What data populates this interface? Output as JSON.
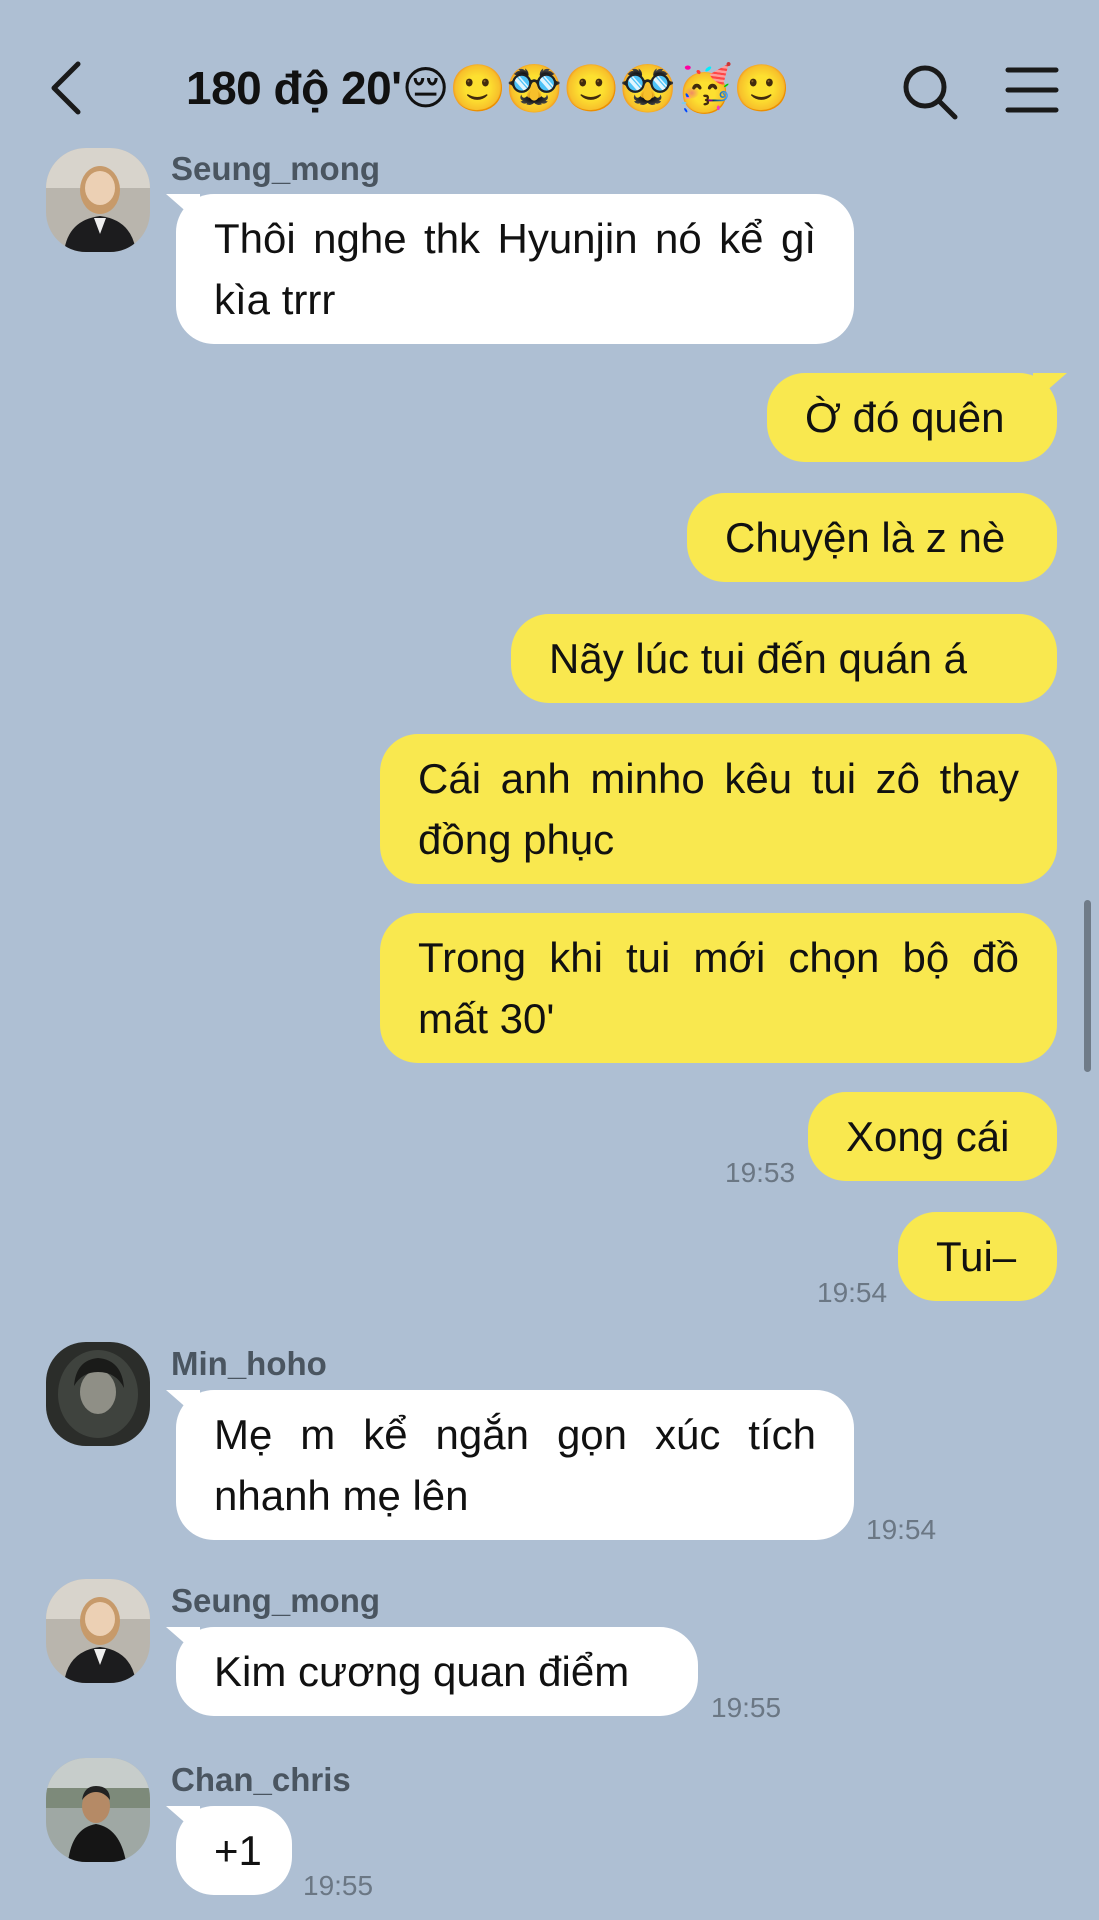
{
  "header": {
    "title": "180 độ 20'😔🙂🥸🙂🥸🥳🙂",
    "back_icon": "chevron-left-icon",
    "search_icon": "search-icon",
    "menu_icon": "hamburger-menu-icon"
  },
  "colors": {
    "background": "#aebfd3",
    "outgoing_bubble": "#f9e84f",
    "incoming_bubble": "#ffffff"
  },
  "messages": [
    {
      "direction": "in",
      "sender": "Seung_mong",
      "text": "Thôi nghe thk Hyunjin nó kể gì kìa trrr"
    },
    {
      "direction": "out",
      "text": "Ờ đó quên"
    },
    {
      "direction": "out",
      "text": "Chuyện là z nè"
    },
    {
      "direction": "out",
      "text": "Nãy lúc tui đến quán á"
    },
    {
      "direction": "out",
      "text": "Cái anh minho kêu tui zô thay đồng phục"
    },
    {
      "direction": "out",
      "text": "Trong khi tui mới chọn bộ đồ mất 30'"
    },
    {
      "direction": "out",
      "text": "Xong cái",
      "time": "19:53"
    },
    {
      "direction": "out",
      "text": "Tui–",
      "time": "19:54"
    },
    {
      "direction": "in",
      "sender": "Min_hoho",
      "text": "Mẹ m kể ngắn gọn xúc tích nhanh mẹ lên",
      "time": "19:54"
    },
    {
      "direction": "in",
      "sender": "Seung_mong",
      "text": "Kim cương quan điểm",
      "time": "19:55"
    },
    {
      "direction": "in",
      "sender": "Chan_chris",
      "text": "+1",
      "time": "19:55"
    }
  ]
}
